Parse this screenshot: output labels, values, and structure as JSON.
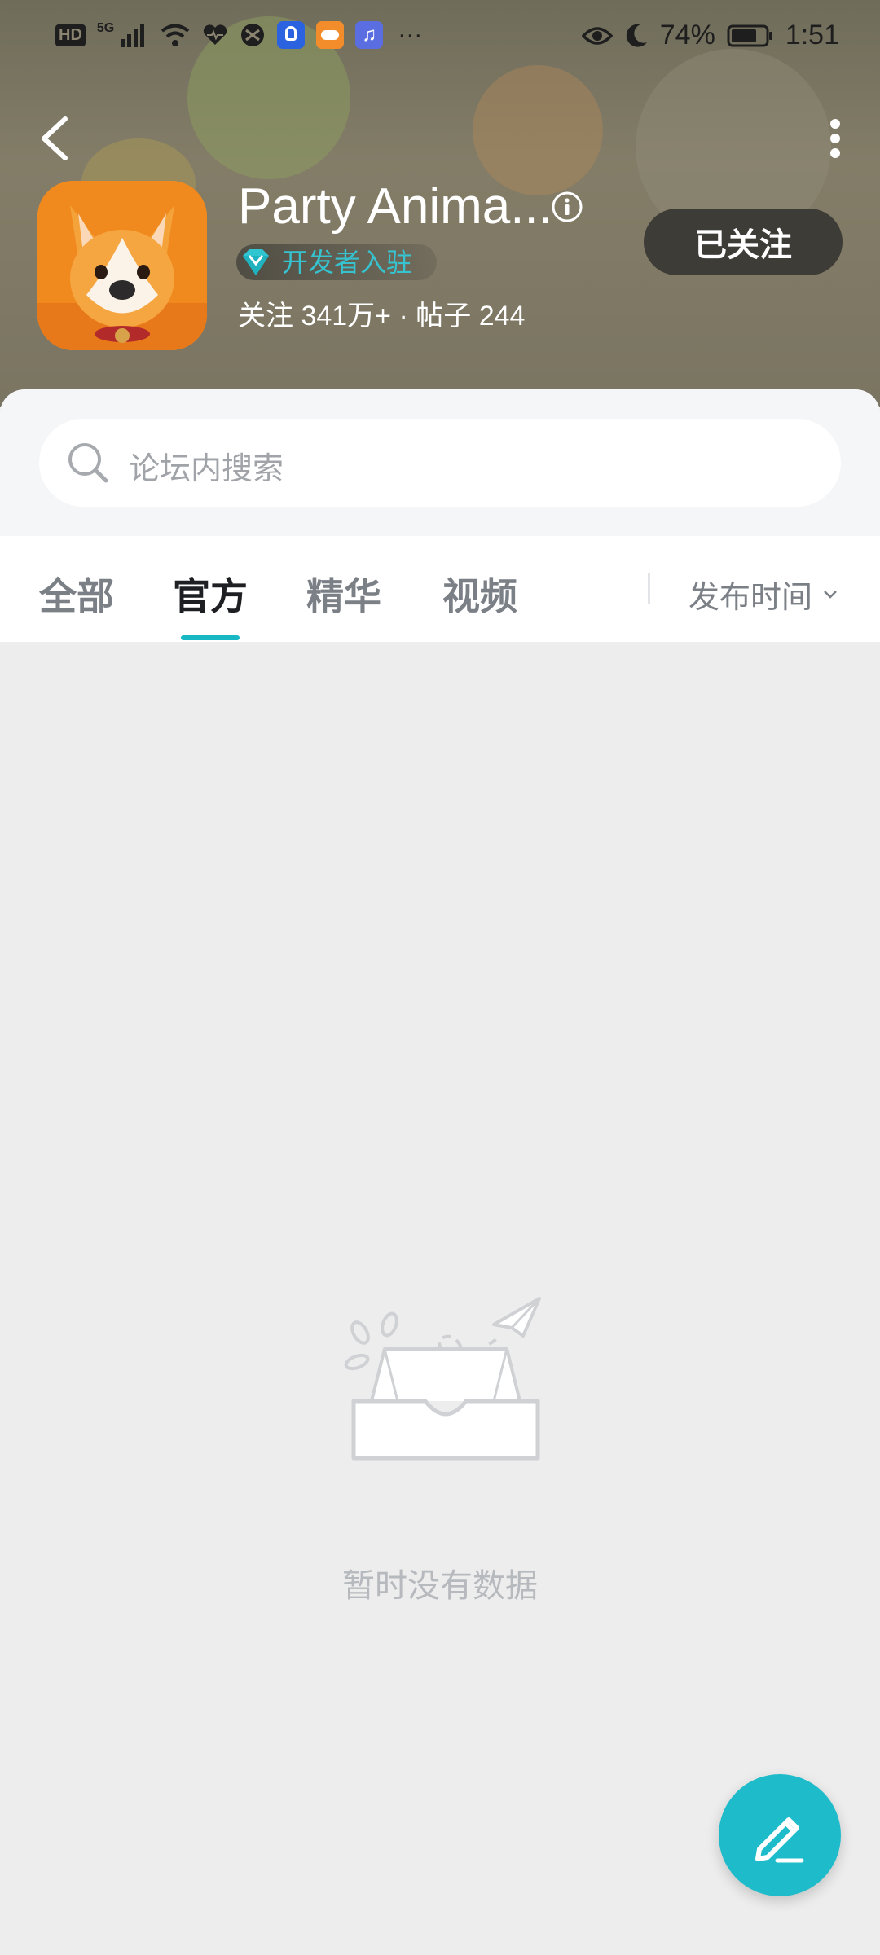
{
  "status_bar": {
    "network_label": "HD",
    "network_type": "5G",
    "battery_percent": "74%",
    "time": "1:51",
    "more_label": "···"
  },
  "header": {
    "title": "Party Anima...",
    "developer_badge": "开发者入驻",
    "stats": "关注 341万+ · 帖子 244",
    "follow_button": "已关注"
  },
  "search": {
    "placeholder": "论坛内搜索"
  },
  "tabs": [
    {
      "label": "全部",
      "active": false
    },
    {
      "label": "官方",
      "active": true
    },
    {
      "label": "精华",
      "active": false
    },
    {
      "label": "视频",
      "active": false
    }
  ],
  "sort": {
    "label": "发布时间"
  },
  "empty_state": {
    "message": "暂时没有数据"
  },
  "colors": {
    "accent": "#17b7c4",
    "fab": "#1ebccb",
    "badge_text": "#36c3cf",
    "follow_button_bg": "#3e3c37",
    "page_bg": "#ededed"
  },
  "icons": [
    "back-arrow-icon",
    "more-vertical-icon",
    "info-icon",
    "diamond-icon",
    "search-icon",
    "chevron-down-icon",
    "empty-inbox-icon",
    "edit-pen-icon"
  ]
}
